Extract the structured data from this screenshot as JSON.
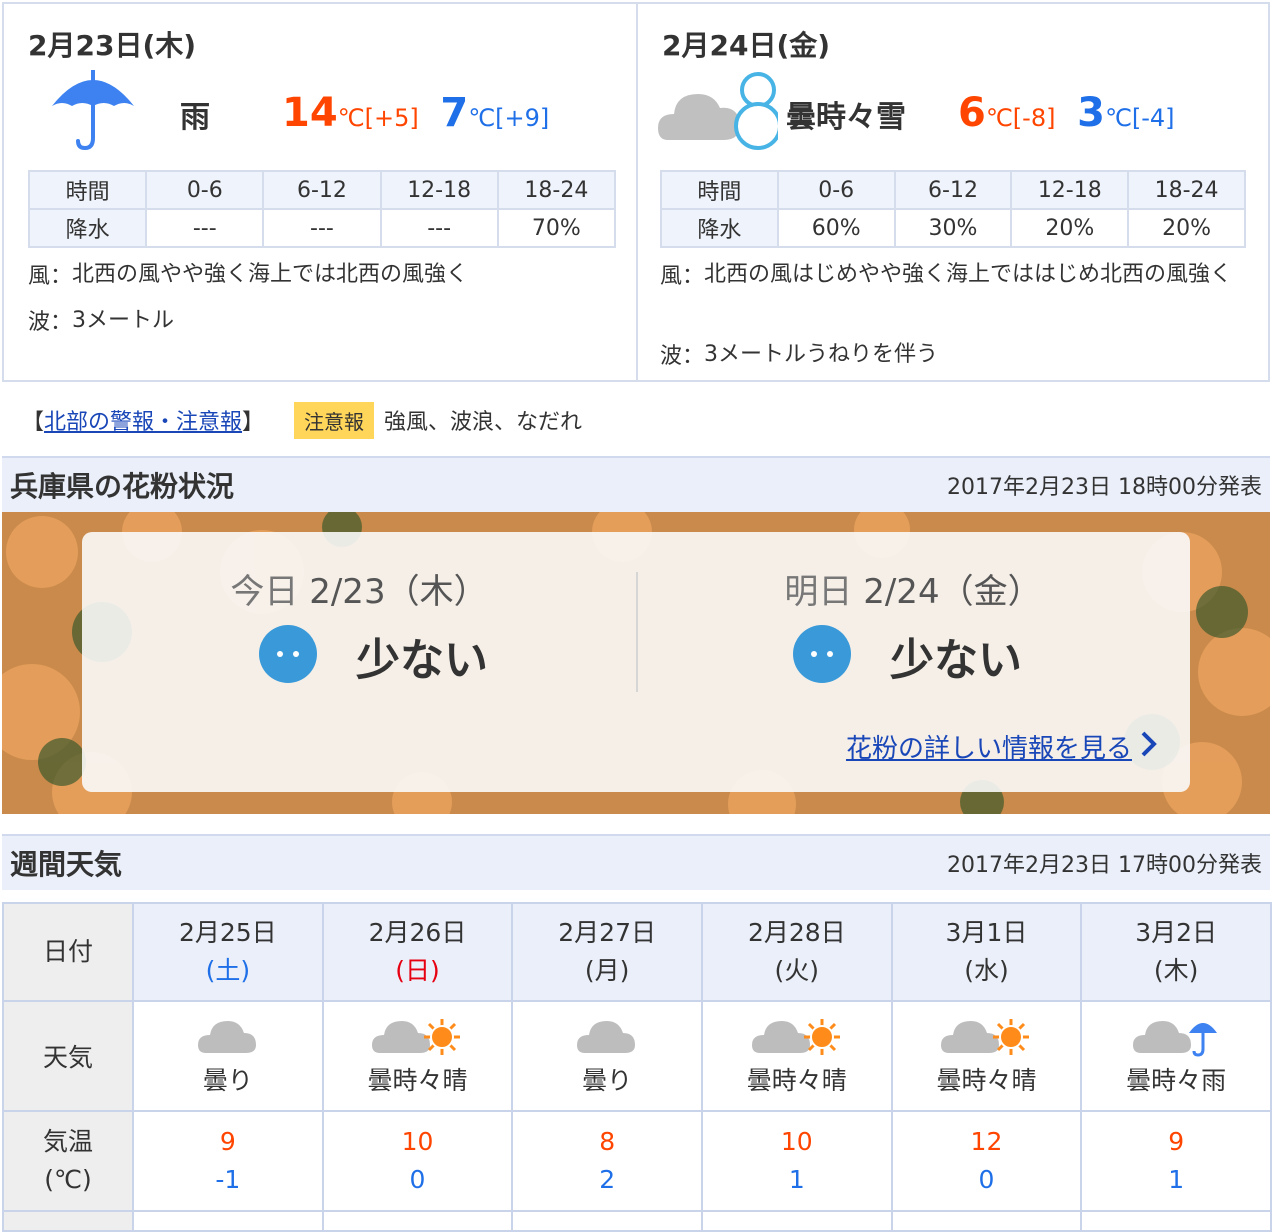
{
  "today": {
    "date": "2月23日(木)",
    "weather": "雨",
    "icon": "umbrella-icon",
    "high": "14",
    "high_diff": "[+5]",
    "low": "7",
    "low_diff": "[+9]",
    "unit": "℃",
    "precip_header": [
      "時間",
      "0-6",
      "6-12",
      "12-18",
      "18-24"
    ],
    "precip_values": [
      "降水",
      "---",
      "---",
      "---",
      "70%"
    ],
    "wind_label": "風：",
    "wind": "北西の風やや強く海上では北西の風強く",
    "wave_label": "波：",
    "wave": "3メートル"
  },
  "tomorrow": {
    "date": "2月24日(金)",
    "weather": "曇時々雪",
    "icon": "cloud-snowman-icon",
    "high": "6",
    "high_diff": "[-8]",
    "low": "3",
    "low_diff": "[-4]",
    "unit": "℃",
    "precip_header": [
      "時間",
      "0-6",
      "6-12",
      "12-18",
      "18-24"
    ],
    "precip_values": [
      "降水",
      "60%",
      "30%",
      "20%",
      "20%"
    ],
    "wind_label": "風：",
    "wind": "北西の風はじめやや強く海上でははじめ北西の風強く",
    "wave_label": "波：",
    "wave": "3メートルうねりを伴う"
  },
  "warning": {
    "open": "【",
    "link": "北部の警報・注意報",
    "close": "】",
    "badge": "注意報",
    "text": "強風、波浪、なだれ"
  },
  "pollen": {
    "title": "兵庫県の花粉状況",
    "issued": "2017年2月23日 18時00分発表",
    "days": [
      {
        "label": "今日",
        "date": "2/23（木）",
        "level": "少ない",
        "icon": "pollen-face-icon"
      },
      {
        "label": "明日",
        "date": "2/24（金）",
        "level": "少ない",
        "icon": "pollen-face-icon"
      }
    ],
    "link": "花粉の詳しい情報を見る"
  },
  "weekly": {
    "title": "週間天気",
    "issued": "2017年2月23日 17時00分発表",
    "row_date": "日付",
    "row_weather": "天気",
    "row_temp_1": "気温",
    "row_temp_2": "(℃)",
    "days": [
      {
        "date": "2月25日",
        "dow": "(土)",
        "weather": "曇り",
        "icon": "cloud-icon",
        "high": "9",
        "low": "-1"
      },
      {
        "date": "2月26日",
        "dow": "(日)",
        "weather": "曇時々晴",
        "icon": "cloud-sun-icon",
        "high": "10",
        "low": "0"
      },
      {
        "date": "2月27日",
        "dow": "(月)",
        "weather": "曇り",
        "icon": "cloud-icon",
        "high": "8",
        "low": "2"
      },
      {
        "date": "2月28日",
        "dow": "(火)",
        "weather": "曇時々晴",
        "icon": "cloud-sun-icon",
        "high": "10",
        "low": "1"
      },
      {
        "date": "3月1日",
        "dow": "(水)",
        "weather": "曇時々晴",
        "icon": "cloud-sun-icon",
        "high": "12",
        "low": "0"
      },
      {
        "date": "3月2日",
        "dow": "(木)",
        "weather": "曇時々雨",
        "icon": "cloud-umbrella-icon",
        "high": "9",
        "low": "1"
      }
    ]
  },
  "colors": {
    "high": "#ff4500",
    "low": "#1e6fe8",
    "link": "#1a47b8",
    "badge": "#ffd659",
    "pollen_face": "#3a9ad9"
  }
}
